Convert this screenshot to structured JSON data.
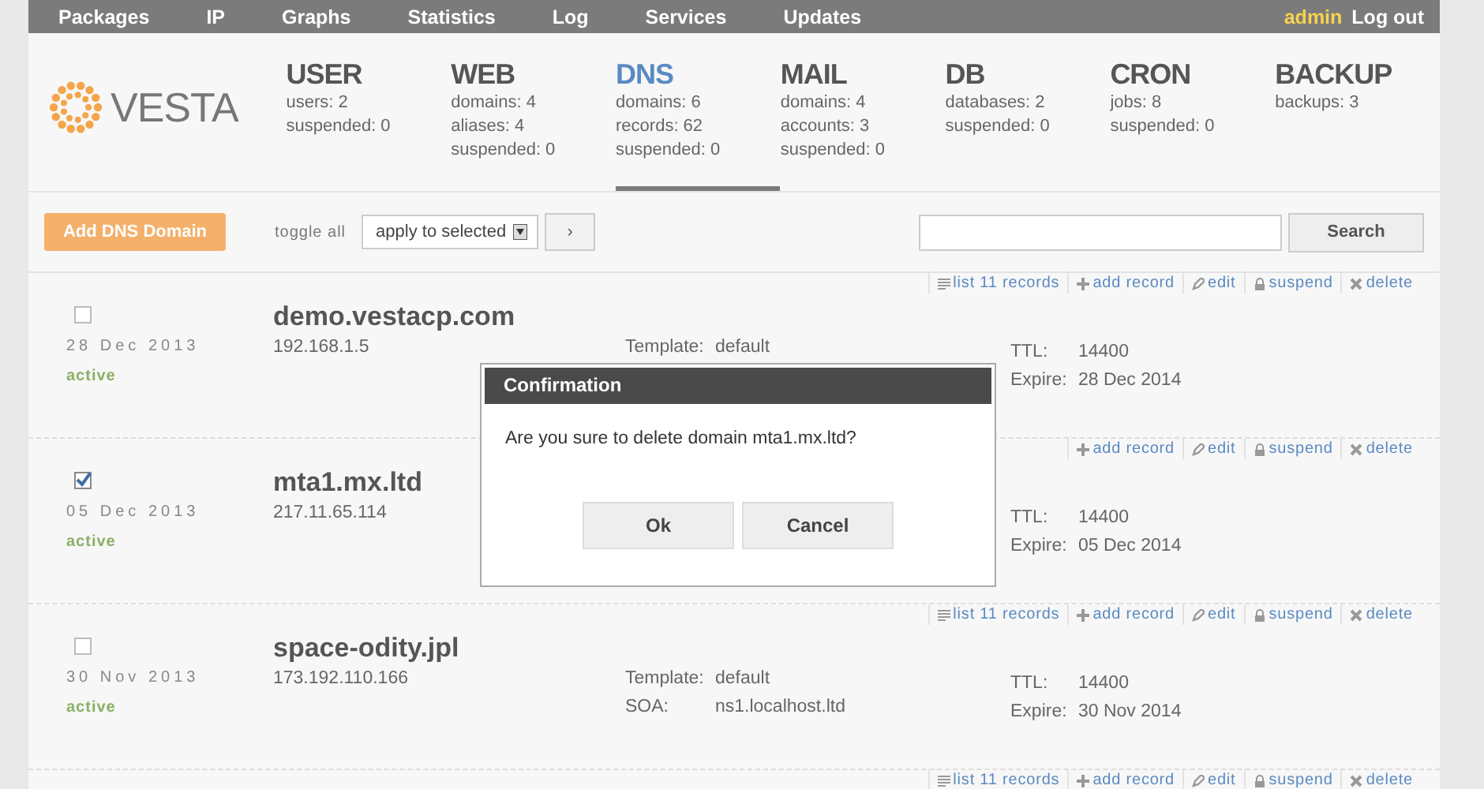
{
  "top_menu": [
    "Packages",
    "IP",
    "Graphs",
    "Statistics",
    "Log",
    "Services",
    "Updates"
  ],
  "user": {
    "name": "admin",
    "logout": "Log out"
  },
  "logo": "VESTA",
  "stats": [
    {
      "title": "USER",
      "selected": false,
      "lines": [
        "users: 2",
        "suspended: 0"
      ]
    },
    {
      "title": "WEB",
      "selected": false,
      "lines": [
        "domains: 4",
        "aliases: 4",
        "suspended: 0"
      ]
    },
    {
      "title": "DNS",
      "selected": true,
      "lines": [
        "domains: 6",
        "records: 62",
        "suspended: 0"
      ]
    },
    {
      "title": "MAIL",
      "selected": false,
      "lines": [
        "domains: 4",
        "accounts: 3",
        "suspended: 0"
      ]
    },
    {
      "title": "DB",
      "selected": false,
      "lines": [
        "databases: 2",
        "suspended: 0"
      ]
    },
    {
      "title": "CRON",
      "selected": false,
      "lines": [
        "jobs: 8",
        "suspended: 0"
      ]
    },
    {
      "title": "BACKUP",
      "selected": false,
      "lines": [
        "backups: 3"
      ]
    }
  ],
  "toolbar": {
    "add_button": "Add DNS Domain",
    "toggle_all": "toggle all",
    "action_select": "apply to selected",
    "apply_button": "›",
    "search_button": "Search"
  },
  "rows": [
    {
      "actions": [
        {
          "kind": "list",
          "label": "list 11 records"
        },
        {
          "kind": "add",
          "label": "add record"
        },
        {
          "kind": "edit",
          "label": "edit"
        },
        {
          "kind": "suspend",
          "label": "suspend"
        },
        {
          "kind": "delete",
          "label": "delete"
        }
      ],
      "checked": false,
      "date": "28 Dec 2013",
      "status": "active",
      "name": "demo.vestacp.com",
      "ip": "192.168.1.5",
      "details": [
        {
          "label": "Template:",
          "value": "default"
        }
      ],
      "ttl_label": "TTL:",
      "ttl": "14400",
      "expire_label": "Expire:",
      "expire": "28 Dec 2014"
    },
    {
      "actions": [
        {
          "kind": "add",
          "label": "add record"
        },
        {
          "kind": "edit",
          "label": "edit"
        },
        {
          "kind": "suspend",
          "label": "suspend"
        },
        {
          "kind": "delete",
          "label": "delete"
        }
      ],
      "checked": true,
      "date": "05 Dec 2013",
      "status": "active",
      "name": "mta1.mx.ltd",
      "ip": "217.11.65.114",
      "details": [],
      "ttl_label": "TTL:",
      "ttl": "14400",
      "expire_label": "Expire:",
      "expire": "05 Dec 2014"
    },
    {
      "actions": [
        {
          "kind": "list",
          "label": "list 11 records"
        },
        {
          "kind": "add",
          "label": "add record"
        },
        {
          "kind": "edit",
          "label": "edit"
        },
        {
          "kind": "suspend",
          "label": "suspend"
        },
        {
          "kind": "delete",
          "label": "delete"
        }
      ],
      "checked": false,
      "date": "30 Nov 2013",
      "status": "active",
      "name": "space-odity.jpl",
      "ip": "173.192.110.166",
      "details": [
        {
          "label": "Template:",
          "value": "default"
        },
        {
          "label": "SOA:",
          "value": "ns1.localhost.ltd"
        }
      ],
      "ttl_label": "TTL:",
      "ttl": "14400",
      "expire_label": "Expire:",
      "expire": "30 Nov 2014"
    },
    {
      "actions": [
        {
          "kind": "list",
          "label": "list 11 records"
        },
        {
          "kind": "add",
          "label": "add record"
        },
        {
          "kind": "edit",
          "label": "edit"
        },
        {
          "kind": "suspend",
          "label": "suspend"
        },
        {
          "kind": "delete",
          "label": "delete"
        }
      ]
    }
  ],
  "dialog": {
    "title": "Confirmation",
    "message": "Are you sure to delete domain mta1.mx.ltd?",
    "buttons": [
      "Ok",
      "Cancel"
    ]
  }
}
